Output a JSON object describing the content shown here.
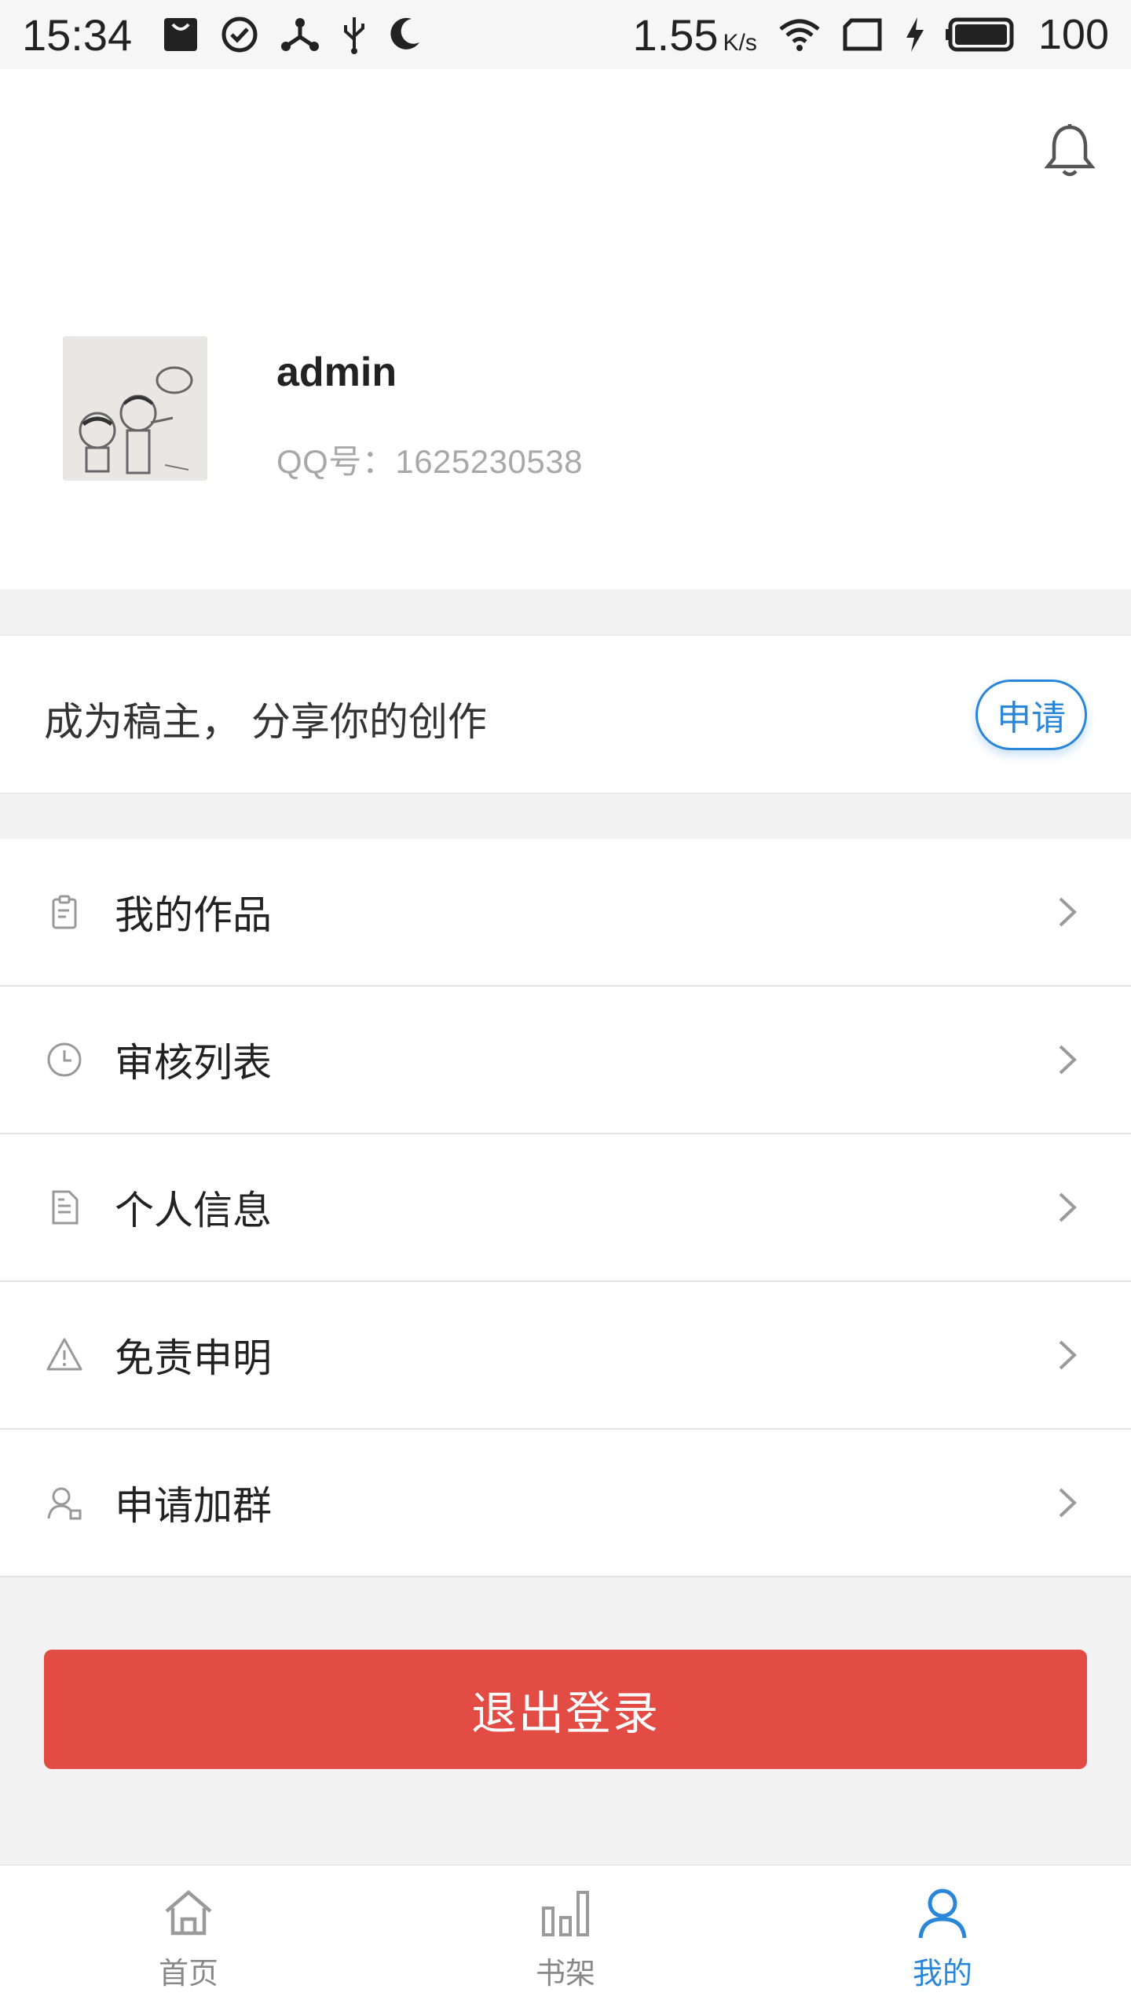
{
  "status_bar": {
    "time": "15:34",
    "speed": "1.55",
    "speed_unit": "K/s",
    "battery": "100"
  },
  "profile": {
    "username": "admin",
    "qq": "QQ号：1625230538"
  },
  "creator": {
    "text": "成为稿主， 分享你的创作",
    "apply_label": "申请"
  },
  "menu": {
    "items": [
      {
        "label": "我的作品",
        "icon": "clipboard-icon"
      },
      {
        "label": "审核列表",
        "icon": "clock-icon"
      },
      {
        "label": "个人信息",
        "icon": "document-icon"
      },
      {
        "label": "免责申明",
        "icon": "warning-icon"
      },
      {
        "label": "申请加群",
        "icon": "user-group-icon"
      }
    ]
  },
  "logout_label": "退出登录",
  "nav": {
    "items": [
      {
        "label": "首页",
        "icon": "home-icon"
      },
      {
        "label": "书架",
        "icon": "bar-chart-icon"
      },
      {
        "label": "我的",
        "icon": "user-icon"
      }
    ],
    "active": "我的"
  },
  "colors": {
    "accent": "#2a86d8",
    "logout": "#e24c44",
    "background": "#f2f2f2"
  }
}
